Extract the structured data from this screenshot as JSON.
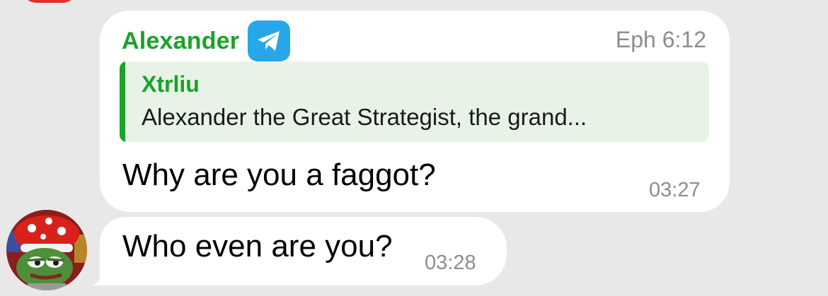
{
  "message_1": {
    "sender": "Alexander",
    "sender_badge_icon": "telegram-icon",
    "header_time": "Eph 6:12",
    "reply": {
      "author": "Xtrliu",
      "text": "Alexander the Great Strategist, the grand..."
    },
    "text": "Why are you a faggot?",
    "time": "03:27"
  },
  "message_2": {
    "text": "Who even are you?",
    "time": "03:28",
    "avatar_icon": "pepe-mushroom-hat-avatar"
  },
  "colors": {
    "background": "#e8e8e8",
    "bubble": "#ffffff",
    "accent_green": "#1ba22a",
    "reply_bg": "#e8f3e7",
    "timestamp": "#8d8d8d",
    "telegram_blue": "#28a7e8"
  }
}
